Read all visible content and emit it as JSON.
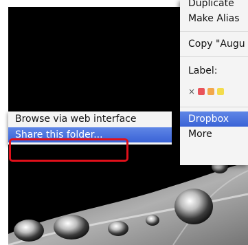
{
  "context_menu": {
    "items": [
      {
        "label": "Duplicate"
      },
      {
        "label": "Make Alias"
      },
      {
        "label": "Copy \"Augu"
      },
      {
        "label": "Label:"
      },
      {
        "label": "Dropbox"
      },
      {
        "label": "More"
      }
    ],
    "label_clear_symbol": "×",
    "label_colors": [
      "#e9535a",
      "#f2a74b",
      "#f3dc4d"
    ]
  },
  "submenu": {
    "items": [
      {
        "label": "Browse via web interface"
      },
      {
        "label": "Share this folder..."
      }
    ]
  },
  "colors": {
    "highlight": "#3a63d6",
    "annotation": "#e0101a"
  }
}
